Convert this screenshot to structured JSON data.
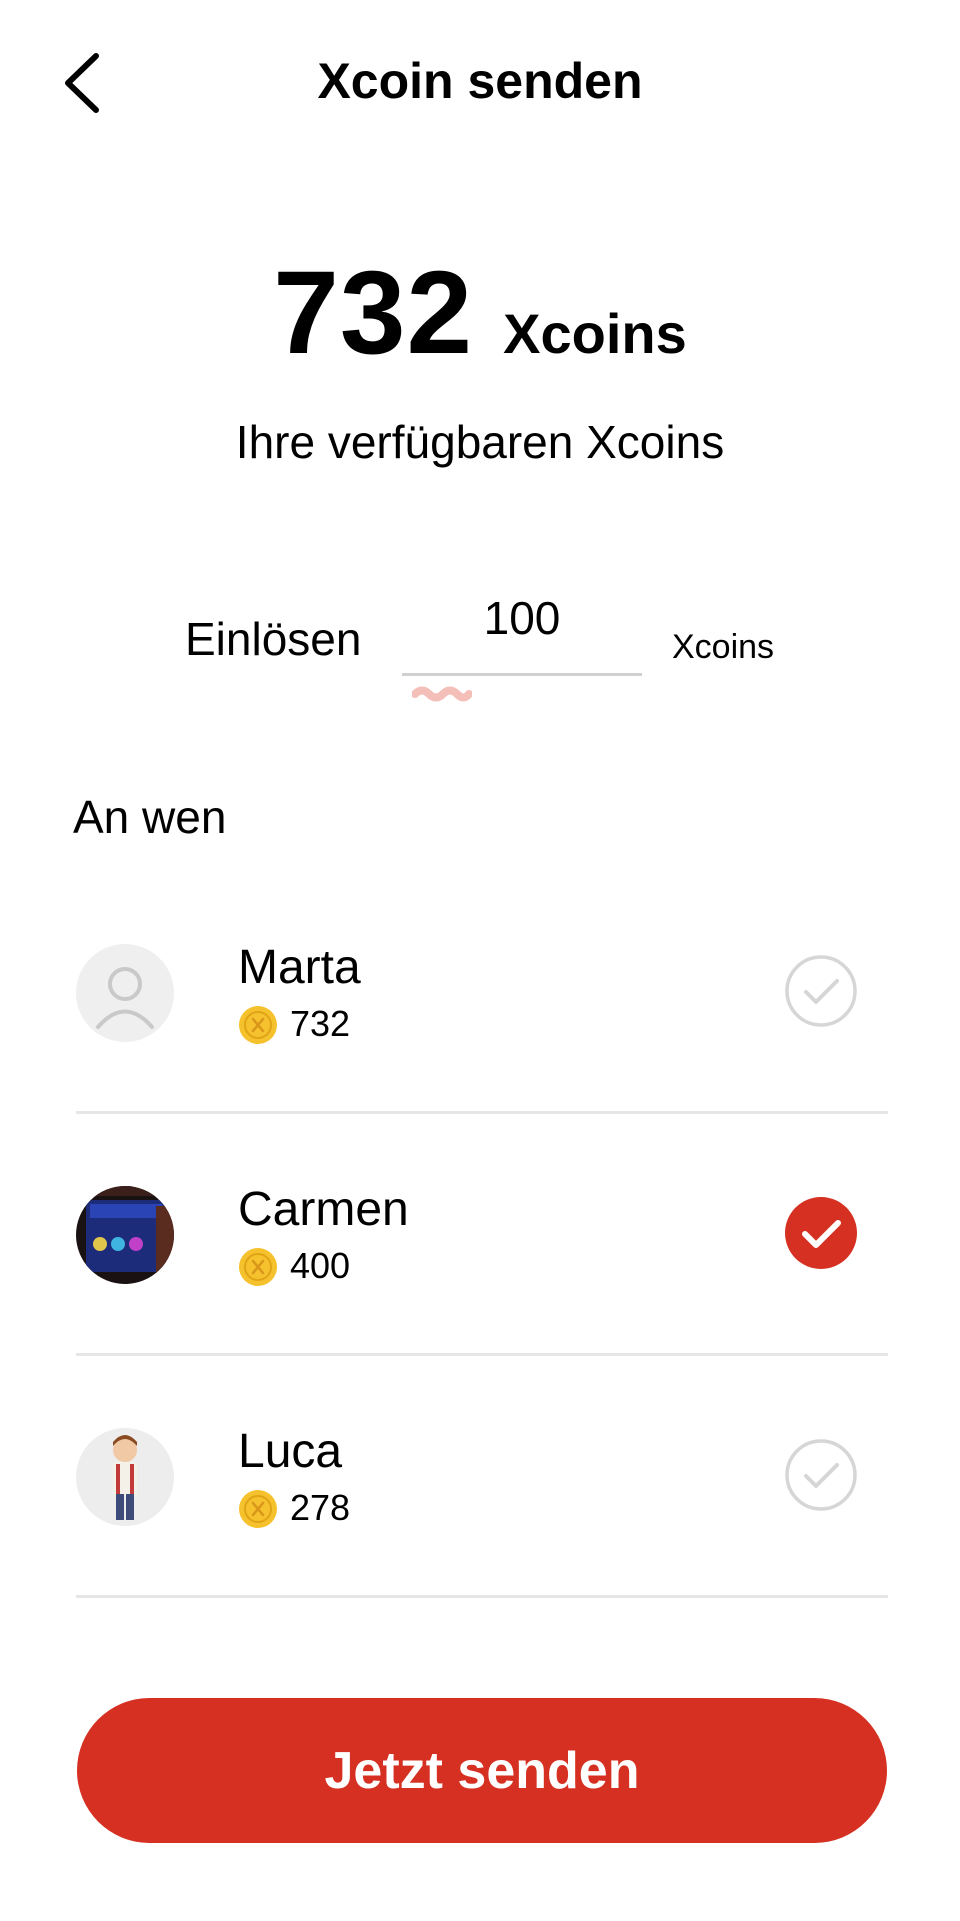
{
  "header": {
    "title": "Xcoin senden",
    "back_icon": "chevron-left-icon"
  },
  "balance": {
    "amount": "732",
    "unit": "Xcoins",
    "label": "Ihre verfügbaren Xcoins"
  },
  "redeem": {
    "label": "Einlösen",
    "value": "100",
    "unit": "Xcoins"
  },
  "recipients": {
    "label": "An wen",
    "items": [
      {
        "name": "Marta",
        "coins": "732",
        "selected": false,
        "avatar": "default-avatar-icon"
      },
      {
        "name": "Carmen",
        "coins": "400",
        "selected": true,
        "avatar": "watch-photo-avatar"
      },
      {
        "name": "Luca",
        "coins": "278",
        "selected": false,
        "avatar": "cartoon-boy-avatar"
      }
    ]
  },
  "action": {
    "send_label": "Jetzt senden"
  },
  "colors": {
    "accent": "#d53021",
    "coin": "#f5c12c",
    "check_outline": "#d6d6d6",
    "divider": "#e6e6e6"
  }
}
